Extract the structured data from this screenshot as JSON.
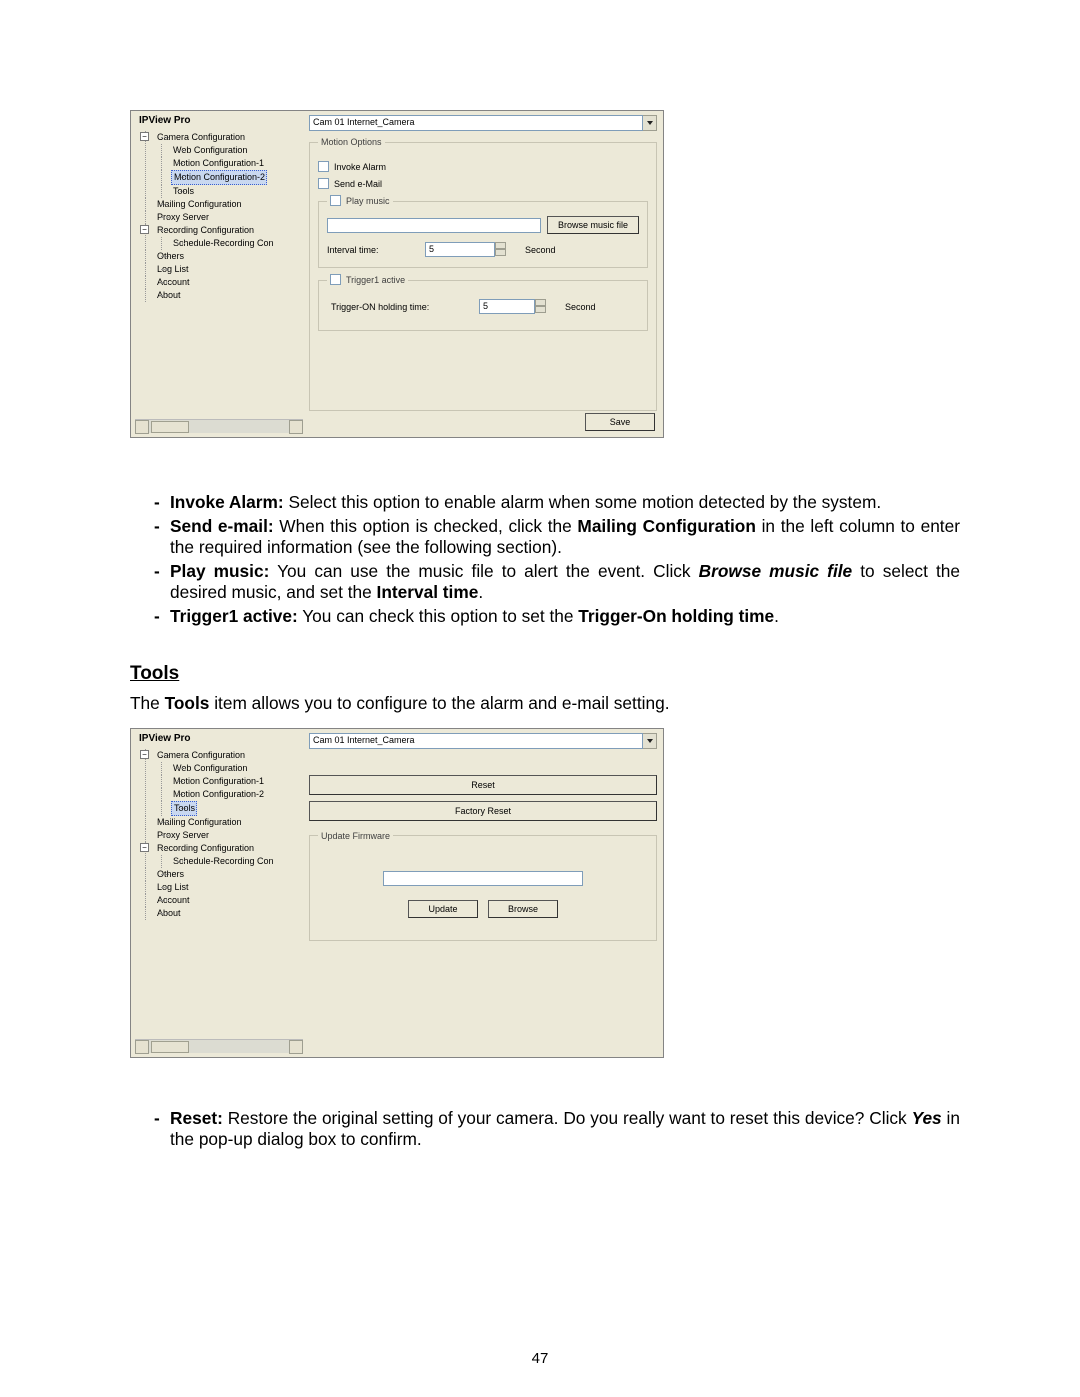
{
  "page_number": "47",
  "screenshot1": {
    "app_title": "IPView Pro",
    "camera_combo": "Cam 01    Internet_Camera",
    "tree": {
      "root": "Camera Configuration",
      "web": "Web Configuration",
      "mc1": "Motion Configuration-1",
      "mc2": "Motion Configuration-2",
      "tools": "Tools",
      "mailing": "Mailing Configuration",
      "proxy": "Proxy Server",
      "recording": "Recording Configuration",
      "sched": "Schedule-Recording Con",
      "others": "Others",
      "loglist": "Log List",
      "account": "Account",
      "about": "About"
    },
    "motion_options_legend": "Motion Options",
    "invoke_alarm": "Invoke Alarm",
    "send_email": "Send e-Mail",
    "play_music_legend": "Play music",
    "browse_music_file": "Browse music file",
    "interval_time_label": "Interval time:",
    "interval_value": "5",
    "second": "Second",
    "trigger_legend": "Trigger1 active",
    "trigger_on_label": "Trigger-ON holding time:",
    "trigger_value": "5",
    "save": "Save"
  },
  "bullets1": {
    "b1_title": "Invoke Alarm:",
    "b1_text": " Select this option to enable alarm when some motion detected by the system.",
    "b2_title": "Send e-mail:",
    "b2_text_a": " When this option is checked, click the ",
    "b2_bold": "Mailing Configuration",
    "b2_text_b": " in the left column to enter the required information (see the following section).",
    "b3_title": "Play music:",
    "b3_text_a": " You can use the music file to alert the event. Click ",
    "b3_bi": "Browse music file",
    "b3_text_b": " to select the desired music, and set the ",
    "b3_bold2": "Interval time",
    "b3_text_c": ".",
    "b4_title": "Trigger1 active:",
    "b4_text_a": " You can check this option to set the ",
    "b4_bold": "Trigger-On holding time",
    "b4_text_b": "."
  },
  "tools_heading": "Tools",
  "tools_intro_a": "The ",
  "tools_intro_bold": "Tools",
  "tools_intro_b": " item allows you to configure to the alarm and e-mail setting.",
  "screenshot2": {
    "app_title": "IPView Pro",
    "camera_combo": "Cam 01    Internet_Camera",
    "reset": "Reset",
    "factory_reset": "Factory Reset",
    "update_fw_legend": "Update Firmware",
    "update": "Update",
    "browse": "Browse"
  },
  "bullets2": {
    "b1_title": "Reset:",
    "b1_text_a": " Restore the original setting of your camera. Do you really want to reset this device? Click ",
    "b1_bi": "Yes",
    "b1_text_b": " in the pop-up dialog box to confirm."
  }
}
